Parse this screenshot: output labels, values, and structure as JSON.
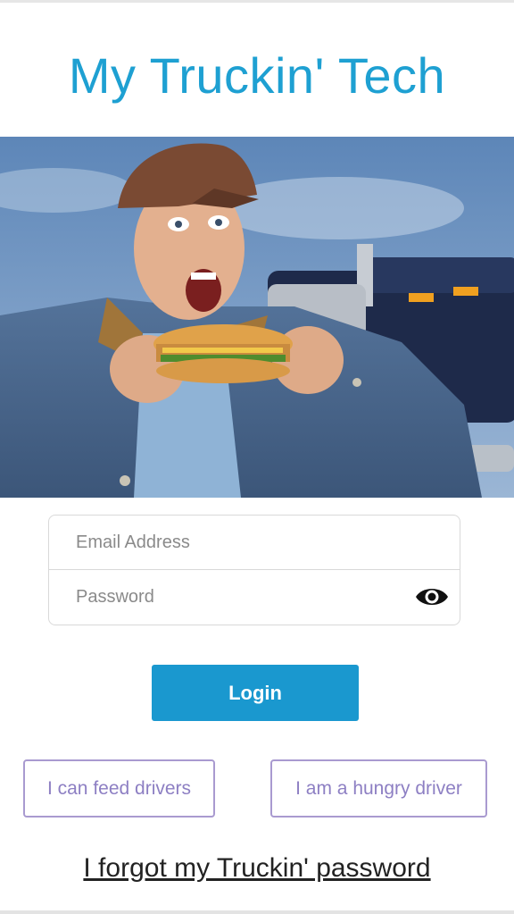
{
  "app": {
    "title": "My Truckin' Tech"
  },
  "hero": {
    "image": "trucker-eating-sandwich"
  },
  "login_form": {
    "email": {
      "placeholder": "Email Address",
      "value": ""
    },
    "password": {
      "placeholder": "Password",
      "value": "",
      "toggle_icon": "eye-icon"
    },
    "login_label": "Login"
  },
  "roles": {
    "feed_label": "I can feed drivers",
    "hungry_label": "I am a hungry driver"
  },
  "forgot_label": "I forgot my Truckin' password",
  "colors": {
    "brand": "#1ea0d2",
    "login_button": "#1a98cf",
    "role_border": "#a99ad0",
    "role_text": "#8d7fc3"
  }
}
